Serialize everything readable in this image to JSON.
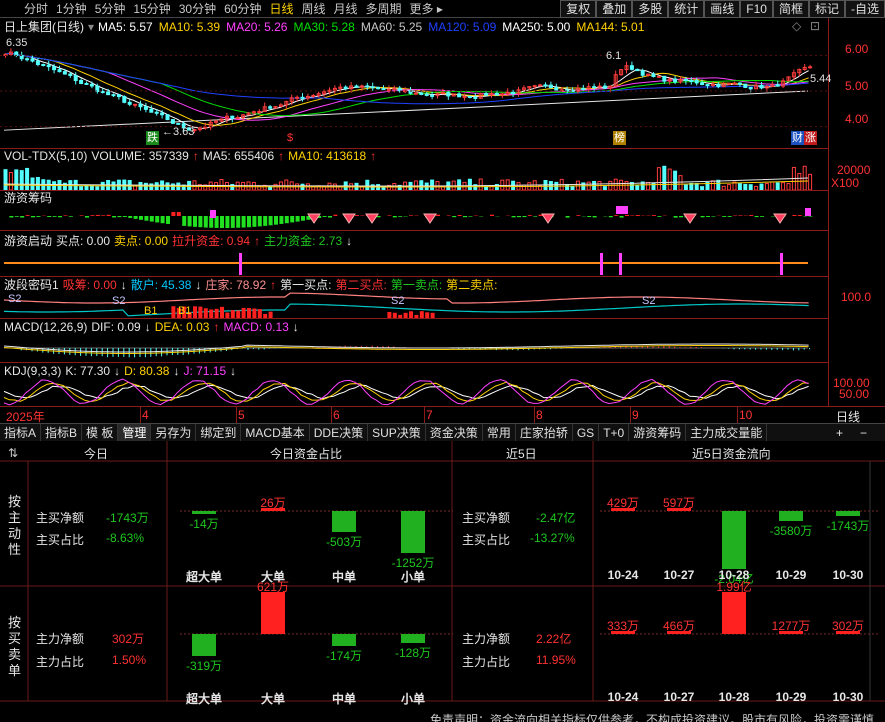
{
  "toolbar": {
    "tabs": [
      "分时",
      "1分钟",
      "5分钟",
      "15分钟",
      "30分钟",
      "60分钟",
      "日线",
      "周线",
      "月线",
      "多周期",
      "更多"
    ],
    "active": "日线",
    "right_buttons": [
      "复权",
      "叠加",
      "多股",
      "统计",
      "画线",
      "F10",
      "简框",
      "标记",
      "-自选"
    ]
  },
  "main_chart": {
    "title": "日上集团(日线)",
    "ma": [
      {
        "label": "MA5: 5.57",
        "color": "#ffffff"
      },
      {
        "label": "MA10: 5.39",
        "color": "#ffd200"
      },
      {
        "label": "MA20: 5.26",
        "color": "#ff40ff"
      },
      {
        "label": "MA30: 5.28",
        "color": "#00e000"
      },
      {
        "label": "MA60: 5.25",
        "color": "#c8c8c8"
      },
      {
        "label": "MA120: 5.09",
        "color": "#2040ff"
      },
      {
        "label": "MA250: 5.00",
        "color": "#ffffff"
      },
      {
        "label": "MA144: 5.01",
        "color": "#ffd200"
      }
    ],
    "price_labels": [
      "6.00",
      "5.00",
      "4.00"
    ],
    "high_label": "6.35",
    "low_label": "3.63",
    "right_price": "5.44",
    "high_right": "6.1",
    "markers": [
      "跌",
      "$",
      "榜",
      "财",
      "涨"
    ]
  },
  "vol": {
    "title": "VOL-TDX(5,10)",
    "volume": "VOLUME: 357339",
    "ma5": "MA5: 655406",
    "ma10": "MA10: 413618",
    "scale": "20000",
    "unit": "X100"
  },
  "chips": {
    "title": "游资筹码"
  },
  "start": {
    "title": "游资启动",
    "buy": "买点: 0.00",
    "sell": "卖点: 0.00",
    "lift": "拉升资金: 0.94",
    "main": "主力资金: 2.73"
  },
  "wave": {
    "title": "波段密码1",
    "absorb": "吸筹: 0.00",
    "retail": "散户: 45.38",
    "dealer": "庄家: 78.92",
    "buy1": "第一买点:",
    "buy2": "第二买点:",
    "sell1": "第一卖点:",
    "sell2": "第二卖点:",
    "scale": "100.0",
    "tags": [
      "S2",
      "S2",
      "B1",
      "B1",
      "S2",
      "S2"
    ]
  },
  "macd": {
    "title": "MACD(12,26,9)",
    "dif": "DIF: 0.09",
    "dea": "DEA: 0.03",
    "macd": "MACD: 0.13"
  },
  "kdj": {
    "title": "KDJ(9,3,3)",
    "k": "K: 77.30",
    "d": "D: 80.38",
    "j": "J: 71.15",
    "scale1": "100.00",
    "scale2": "50.00"
  },
  "timeline": {
    "year": "2025年",
    "months": [
      "4",
      "5",
      "6",
      "7",
      "8",
      "9",
      "10"
    ],
    "period": "日线"
  },
  "tabs": [
    "指标A",
    "指标B",
    "模 板",
    "管理",
    "另存为",
    "绑定到",
    "MACD基本",
    "DDE决策",
    "SUP决策",
    "资金决策",
    "常用",
    "庄家抬轿",
    "GS",
    "T+0",
    "游资筹码",
    "主力成交量能"
  ],
  "active_tab": "管理",
  "flow": {
    "today": "今日",
    "today_ratio": "今日资金占比",
    "last5": "近5日",
    "last5_flow": "近5日资金流向",
    "left_label_top": [
      "按",
      "主",
      "动",
      "性"
    ],
    "left_label_bottom": [
      "按",
      "买",
      "卖",
      "单"
    ],
    "active": {
      "net_label": "主买净额",
      "net_value": "-1743万",
      "ratio_label": "主买占比",
      "ratio_value": "-8.63%",
      "bars": [
        {
          "cat": "超大单",
          "value": "-14万",
          "amount": -14
        },
        {
          "cat": "大单",
          "value": "26万",
          "amount": 26
        },
        {
          "cat": "中单",
          "value": "-503万",
          "amount": -503
        },
        {
          "cat": "小单",
          "value": "-1252万",
          "amount": -1252
        }
      ],
      "net5_label": "主买净额",
      "net5_value": "-2.47亿",
      "ratio5_label": "主买占比",
      "ratio5_value": "-13.27%",
      "days": [
        {
          "date": "10-24",
          "value": "429万",
          "amount": 429
        },
        {
          "date": "10-27",
          "value": "597万",
          "amount": 597
        },
        {
          "date": "10-28",
          "value": "-2.04亿",
          "amount": -20400
        },
        {
          "date": "10-29",
          "value": "-3580万",
          "amount": -3580
        },
        {
          "date": "10-30",
          "value": "-1743万",
          "amount": -1743
        }
      ]
    },
    "order": {
      "net_label": "主力净额",
      "net_value": "302万",
      "ratio_label": "主力占比",
      "ratio_value": "1.50%",
      "bars": [
        {
          "cat": "超大单",
          "value": "-319万",
          "amount": -319
        },
        {
          "cat": "大单",
          "value": "621万",
          "amount": 621
        },
        {
          "cat": "中单",
          "value": "-174万",
          "amount": -174
        },
        {
          "cat": "小单",
          "value": "-128万",
          "amount": -128
        }
      ],
      "net5_label": "主力净额",
      "net5_value": "2.22亿",
      "ratio5_label": "主力占比",
      "ratio5_value": "11.95%",
      "days": [
        {
          "date": "10-24",
          "value": "333万",
          "amount": 333
        },
        {
          "date": "10-27",
          "value": "466万",
          "amount": 466
        },
        {
          "date": "10-28",
          "value": "1.99亿",
          "amount": 19900
        },
        {
          "date": "10-29",
          "value": "1277万",
          "amount": 1277
        },
        {
          "date": "10-30",
          "value": "302万",
          "amount": 302
        }
      ]
    },
    "disclaimer": "免责声明：资金流向相关指标仅供参考，不构成投资建议。股市有风险，投资需谨慎"
  }
}
